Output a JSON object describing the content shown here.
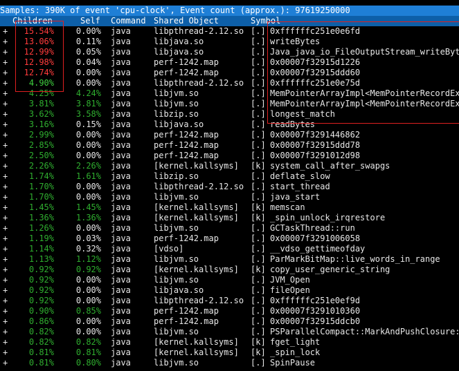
{
  "header": {
    "title": "Samples: 390K of event 'cpu-clock', Event count (approx.): 97619250000"
  },
  "columns": {
    "children": "Children",
    "self": "Self",
    "command": "Command",
    "shared_object": "Shared Object",
    "symbol": "Symbol"
  },
  "colors": {
    "header_bg": "#1f7fd6",
    "column_header_bg": "#0d5fa8",
    "hot_percent": "#ff3b3b",
    "warm_percent": "#3fcf3f",
    "highlight_box": "#e02020"
  },
  "rows": [
    {
      "plus": "+",
      "children": "15.54%",
      "self": "0.00%",
      "command": "java",
      "object": "libpthread-2.12.so",
      "level": "[.]",
      "symbol": "0xffffffc251e0e6fd",
      "heat": "hot"
    },
    {
      "plus": "+",
      "children": "13.06%",
      "self": "0.11%",
      "command": "java",
      "object": "libjava.so",
      "level": "[.]",
      "symbol": "writeBytes",
      "heat": "hot"
    },
    {
      "plus": "+",
      "children": "12.99%",
      "self": "0.05%",
      "command": "java",
      "object": "libjava.so",
      "level": "[.]",
      "symbol": "Java_java_io_FileOutputStream_writeBytes",
      "heat": "hot"
    },
    {
      "plus": "+",
      "children": "12.98%",
      "self": "0.04%",
      "command": "java",
      "object": "perf-1242.map",
      "level": "[.]",
      "symbol": "0x00007f32915d1226",
      "heat": "hot"
    },
    {
      "plus": "+",
      "children": "12.74%",
      "self": "0.00%",
      "command": "java",
      "object": "perf-1242.map",
      "level": "[.]",
      "symbol": "0x00007f32915ddd60",
      "heat": "hot"
    },
    {
      "plus": "+",
      "children": "4.90%",
      "self": "0.00%",
      "command": "java",
      "object": "libpthread-2.12.so",
      "level": "[.]",
      "symbol": "0xffffffc251e0e75d",
      "heat": "warm"
    },
    {
      "plus": "+",
      "children": "4.25%",
      "self": "4.24%",
      "command": "java",
      "object": "libjvm.so",
      "level": "[.]",
      "symbol": "MemPointerArrayImpl<MemPointerRecordEx>",
      "heat": "dim",
      "self_heat": "dim"
    },
    {
      "plus": "+",
      "children": "3.81%",
      "self": "3.81%",
      "command": "java",
      "object": "libjvm.so",
      "level": "[.]",
      "symbol": "MemPointerArrayImpl<MemPointerRecordEx>",
      "heat": "dim",
      "self_heat": "dim"
    },
    {
      "plus": "+",
      "children": "3.62%",
      "self": "3.58%",
      "command": "java",
      "object": "libzip.so",
      "level": "[.]",
      "symbol": "longest_match",
      "heat": "dim",
      "self_heat": "dim"
    },
    {
      "plus": "+",
      "children": "3.16%",
      "self": "0.15%",
      "command": "java",
      "object": "libjava.so",
      "level": "[.]",
      "symbol": "readBytes",
      "heat": "dim"
    },
    {
      "plus": "+",
      "children": "2.99%",
      "self": "0.00%",
      "command": "java",
      "object": "perf-1242.map",
      "level": "[.]",
      "symbol": "0x00007f3291446862",
      "heat": "dim"
    },
    {
      "plus": "+",
      "children": "2.85%",
      "self": "0.00%",
      "command": "java",
      "object": "perf-1242.map",
      "level": "[.]",
      "symbol": "0x00007f32915ddd78",
      "heat": "dim"
    },
    {
      "plus": "+",
      "children": "2.50%",
      "self": "0.00%",
      "command": "java",
      "object": "perf-1242.map",
      "level": "[.]",
      "symbol": "0x00007f3291012d98",
      "heat": "dim"
    },
    {
      "plus": "+",
      "children": "2.26%",
      "self": "2.26%",
      "command": "java",
      "object": "[kernel.kallsyms]",
      "level": "[k]",
      "symbol": "system_call_after_swapgs",
      "heat": "dim",
      "self_heat": "dim"
    },
    {
      "plus": "+",
      "children": "1.74%",
      "self": "1.61%",
      "command": "java",
      "object": "libzip.so",
      "level": "[.]",
      "symbol": "deflate_slow",
      "heat": "dim",
      "self_heat": "dim"
    },
    {
      "plus": "+",
      "children": "1.70%",
      "self": "0.00%",
      "command": "java",
      "object": "libpthread-2.12.so",
      "level": "[.]",
      "symbol": "start_thread",
      "heat": "dim"
    },
    {
      "plus": "+",
      "children": "1.70%",
      "self": "0.00%",
      "command": "java",
      "object": "libjvm.so",
      "level": "[.]",
      "symbol": "java_start",
      "heat": "dim"
    },
    {
      "plus": "+",
      "children": "1.45%",
      "self": "1.45%",
      "command": "java",
      "object": "[kernel.kallsyms]",
      "level": "[k]",
      "symbol": "memscan",
      "heat": "dim",
      "self_heat": "dim"
    },
    {
      "plus": "+",
      "children": "1.36%",
      "self": "1.36%",
      "command": "java",
      "object": "[kernel.kallsyms]",
      "level": "[k]",
      "symbol": "_spin_unlock_irqrestore",
      "heat": "dim",
      "self_heat": "dim"
    },
    {
      "plus": "+",
      "children": "1.26%",
      "self": "0.00%",
      "command": "java",
      "object": "libjvm.so",
      "level": "[.]",
      "symbol": "GCTaskThread::run",
      "heat": "dim"
    },
    {
      "plus": "+",
      "children": "1.19%",
      "self": "0.03%",
      "command": "java",
      "object": "perf-1242.map",
      "level": "[.]",
      "symbol": "0x00007f3291006058",
      "heat": "dim"
    },
    {
      "plus": "+",
      "children": "1.14%",
      "self": "0.32%",
      "command": "java",
      "object": "[vdso]",
      "level": "[.]",
      "symbol": "__vdso_gettimeofday",
      "heat": "dim"
    },
    {
      "plus": "+",
      "children": "1.13%",
      "self": "1.12%",
      "command": "java",
      "object": "libjvm.so",
      "level": "[.]",
      "symbol": "ParMarkBitMap::live_words_in_range",
      "heat": "dim",
      "self_heat": "dim"
    },
    {
      "plus": "+",
      "children": "0.92%",
      "self": "0.92%",
      "command": "java",
      "object": "[kernel.kallsyms]",
      "level": "[k]",
      "symbol": "copy_user_generic_string",
      "heat": "dim",
      "self_heat": "dim"
    },
    {
      "plus": "+",
      "children": "0.92%",
      "self": "0.00%",
      "command": "java",
      "object": "libjvm.so",
      "level": "[.]",
      "symbol": "JVM_Open",
      "heat": "dim"
    },
    {
      "plus": "+",
      "children": "0.92%",
      "self": "0.00%",
      "command": "java",
      "object": "libjava.so",
      "level": "[.]",
      "symbol": "fileOpen",
      "heat": "dim"
    },
    {
      "plus": "+",
      "children": "0.92%",
      "self": "0.00%",
      "command": "java",
      "object": "libpthread-2.12.so",
      "level": "[.]",
      "symbol": "0xffffffc251e0ef9d",
      "heat": "dim"
    },
    {
      "plus": "+",
      "children": "0.90%",
      "self": "0.85%",
      "command": "java",
      "object": "perf-1242.map",
      "level": "[.]",
      "symbol": "0x00007f3291010360",
      "heat": "dim",
      "self_heat": "dim"
    },
    {
      "plus": "+",
      "children": "0.86%",
      "self": "0.00%",
      "command": "java",
      "object": "perf-1242.map",
      "level": "[.]",
      "symbol": "0x00007f32915ddcb0",
      "heat": "dim"
    },
    {
      "plus": "+",
      "children": "0.82%",
      "self": "0.00%",
      "command": "java",
      "object": "libjvm.so",
      "level": "[.]",
      "symbol": "PSParallelCompact::MarkAndPushClosure::",
      "heat": "dim"
    },
    {
      "plus": "+",
      "children": "0.82%",
      "self": "0.82%",
      "command": "java",
      "object": "[kernel.kallsyms]",
      "level": "[k]",
      "symbol": "fget_light",
      "heat": "dim",
      "self_heat": "dim"
    },
    {
      "plus": "+",
      "children": "0.81%",
      "self": "0.81%",
      "command": "java",
      "object": "[kernel.kallsyms]",
      "level": "[k]",
      "symbol": "_spin_lock",
      "heat": "dim",
      "self_heat": "dim"
    },
    {
      "plus": "+",
      "children": "0.81%",
      "self": "0.80%",
      "command": "java",
      "object": "libjvm.so",
      "level": "[.]",
      "symbol": "SpinPause",
      "heat": "dim",
      "self_heat": "dim"
    }
  ]
}
